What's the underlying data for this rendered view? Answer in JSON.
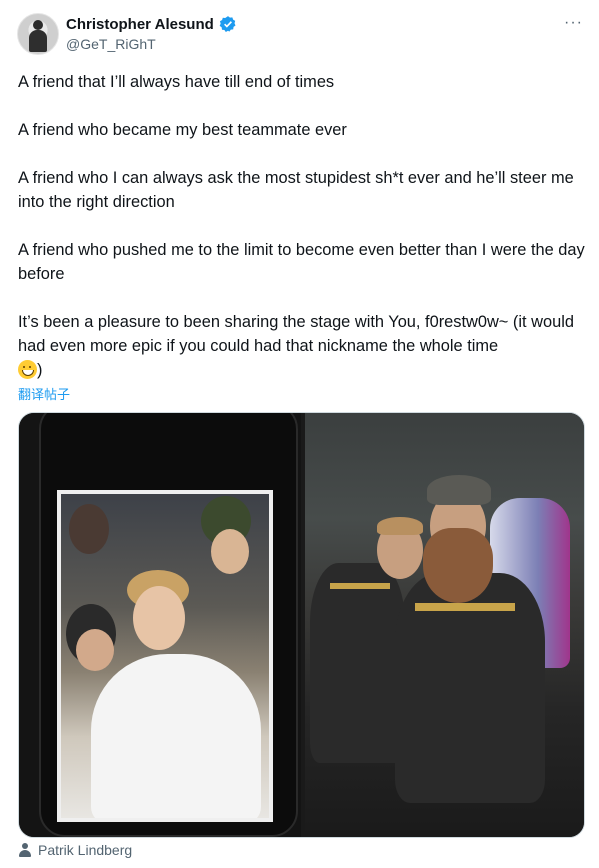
{
  "author": {
    "name": "Christopher Alesund",
    "handle": "@GeT_RiGhT",
    "verified": true
  },
  "more_icon": "more-icon",
  "tweet": {
    "paragraphs": [
      "A friend that I’ll always have till end of times",
      "A friend who became my best teammate ever",
      "A friend who I can always ask the most stupidest sh*t ever and he’ll steer me into the right direction",
      "A friend who pushed me to the limit to become even better than I were the day before",
      "It’s been a pleasure to been sharing the stage with You, f0restw0w~ (it would had even more epic if you could had that nickname the whole time"
    ],
    "closing_paren": ")",
    "emoji": "sweat-smile-emoji"
  },
  "translate_label": "翻译帖子",
  "media": {
    "tagged_person": "Patrik Lindberg"
  },
  "colors": {
    "link": "#1d9bf0",
    "verified": "#1d9bf0",
    "secondary_text": "#536471"
  }
}
